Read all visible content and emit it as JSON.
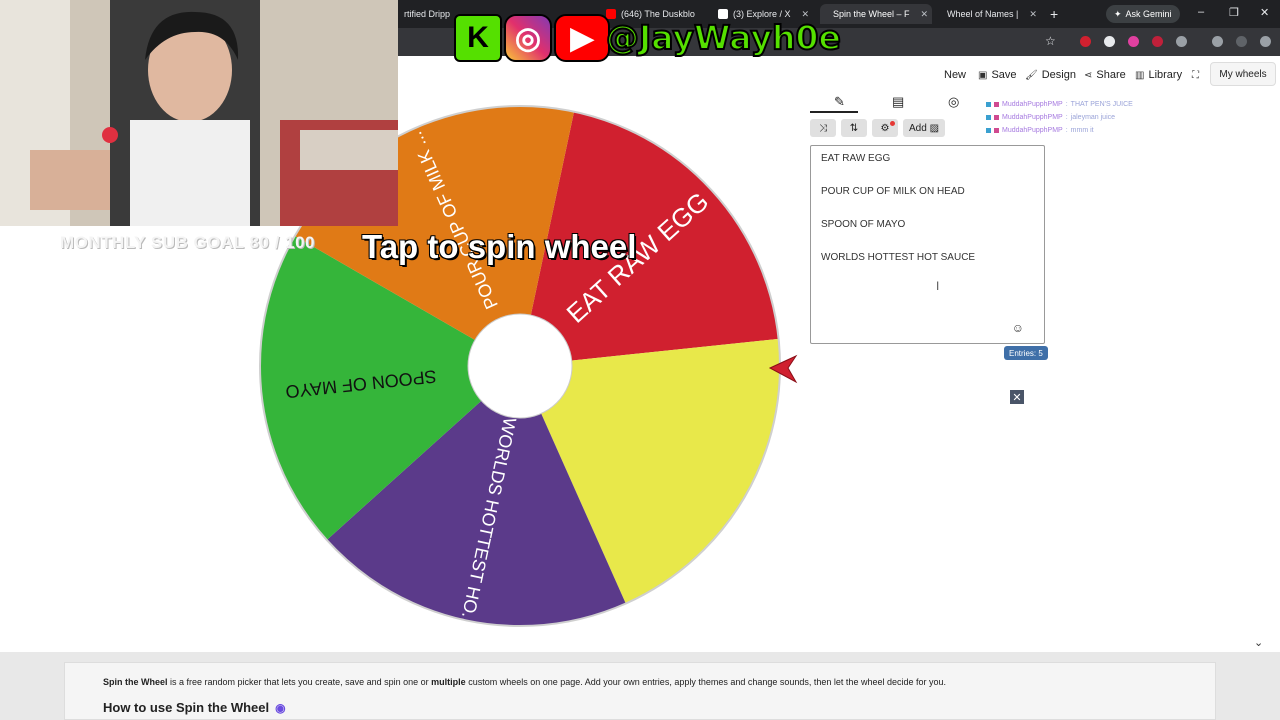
{
  "browser": {
    "tabs": [
      {
        "label": "rtified Dripp",
        "active": false
      },
      {
        "label": "(646) The Duskblo",
        "active": false
      },
      {
        "label": "(3) Explore / X",
        "active": false
      },
      {
        "label": "Spin the Wheel – F",
        "active": true
      },
      {
        "label": "Wheel of Names |",
        "active": false
      }
    ],
    "new_tab": "+",
    "gemini_label": "Ask Gemini",
    "window_controls": [
      "–",
      "❐",
      "✕"
    ]
  },
  "overlay": {
    "handle": "@JayWayh0e",
    "sub_goal": "MONTHLY SUB GOAL 80 / 100",
    "tap_to_spin": "Tap to spin wheel",
    "chat": [
      {
        "name": "MuddahPupphPMP",
        "message": "THAT PEN'S JUICE"
      },
      {
        "name": "MuddahPupphPMP",
        "message": "jaleyman juice"
      },
      {
        "name": "MuddahPupphPMP",
        "message": "mmm it"
      }
    ]
  },
  "app": {
    "nav": {
      "new": "New",
      "save": "Save",
      "design": "Design",
      "share": "Share",
      "library": "Library",
      "fullscreen_icon": "expand-icon",
      "my_wheels": "My wheels"
    },
    "panel": {
      "tabs": [
        "edit-pencil-icon",
        "results-clipboard-icon",
        "hide-eye-icon"
      ],
      "tools": {
        "shuffle": "⤨",
        "sort": "⇅",
        "settings": "⚙",
        "add_image": "Add"
      },
      "entries": [
        "EAT RAW EGG",
        "POUR CUP OF MILK ON HEAD",
        "SPOON OF MAYO",
        "WORLDS HOTTEST HOT SAUCE"
      ],
      "entries_count_label": "Entries: 5",
      "close": "✕"
    }
  },
  "wheel": {
    "segments": [
      {
        "label": "EAT RAW EGG",
        "color": "#d0202f"
      },
      {
        "label": "",
        "color": "#e8e84a"
      },
      {
        "label": "WORLDS HOTTEST HO...",
        "color": "#5b3a8a"
      },
      {
        "label": "SPOON OF MAYO",
        "color": "#35b53a"
      },
      {
        "label": "POUR CUP OF MILK ...",
        "color": "#e07a16"
      }
    ],
    "pointer_color": "#d0202f"
  },
  "footer": {
    "intro_bold": "Spin the Wheel",
    "intro_text": " is a free random picker that lets you create, save and spin one or ",
    "intro_bold2": "multiple",
    "intro_text2": " custom wheels on one page. Add your own entries, apply themes and change sounds, then let the wheel decide for you.",
    "heading": "How to use Spin the Wheel"
  }
}
